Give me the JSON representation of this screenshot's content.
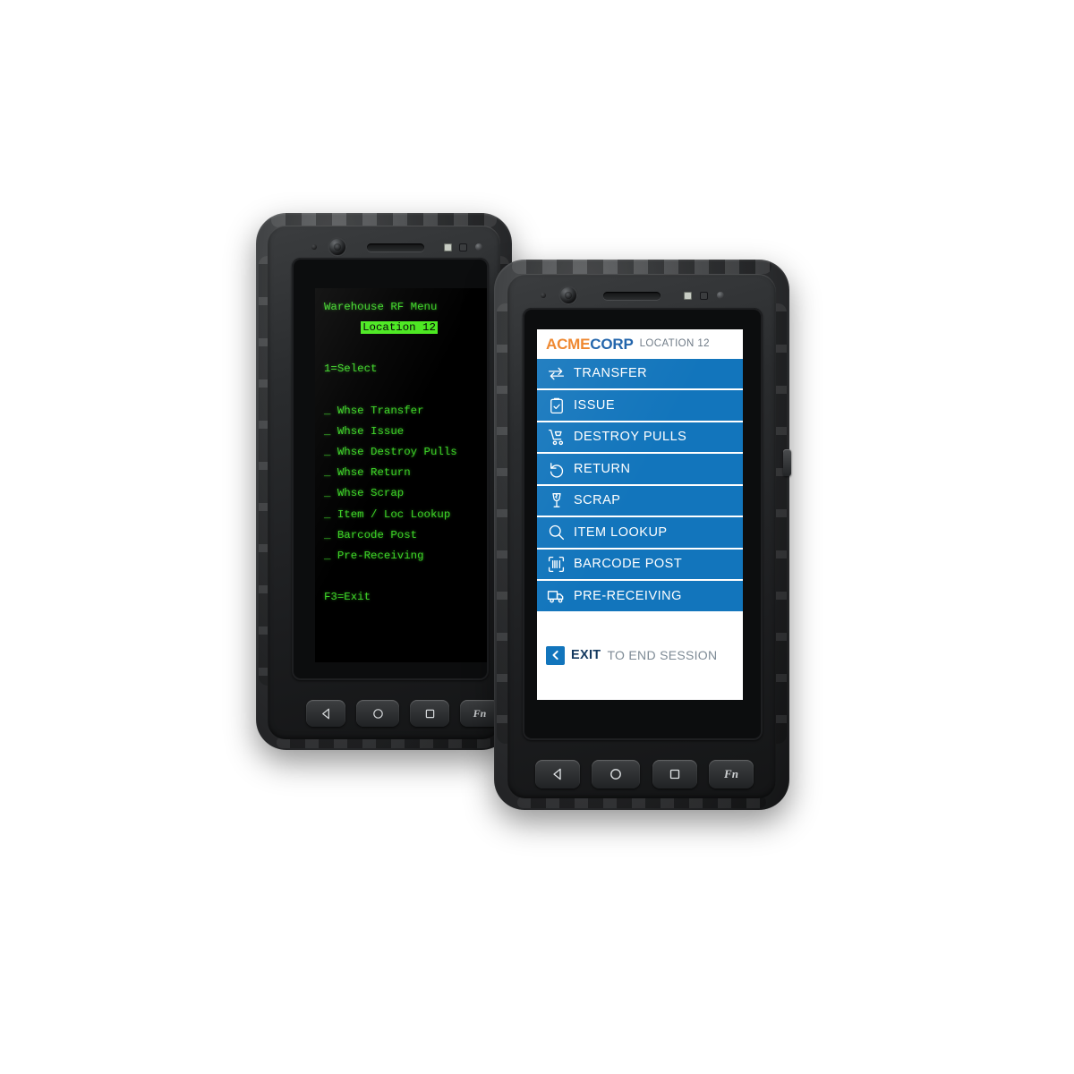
{
  "scene": {
    "background_color": "#ffffff",
    "device_count": 2
  },
  "legacy_device": {
    "name": "Rugged handheld terminal (legacy green-screen)",
    "hardware": {
      "camera_icon": "camera-lens-icon",
      "speaker_icon": "speaker-grille-icon",
      "nav_keys": [
        {
          "name": "back",
          "glyph": "back-triangle-icon",
          "label": ""
        },
        {
          "name": "home",
          "glyph": "home-circle-icon",
          "label": ""
        },
        {
          "name": "recents",
          "glyph": "recents-square-icon",
          "label": ""
        },
        {
          "name": "function",
          "glyph": "fn-key",
          "label": "Fn"
        }
      ]
    },
    "terminal": {
      "text_color": "#3ed428",
      "background_color": "#000000",
      "highlight_bg": "#4ae81f",
      "highlight_fg": "#000000",
      "title": "Warehouse RF Menu",
      "location": "Location 12",
      "prompt": "1=Select",
      "items": [
        "_ Whse Transfer",
        "_ Whse Issue",
        "_ Whse Destroy Pulls",
        "_ Whse Return",
        "_ Whse Scrap",
        "_ Item / Loc Lookup",
        "_ Barcode Post",
        "_ Pre-Receiving"
      ],
      "footer": "F3=Exit"
    }
  },
  "modern_device": {
    "name": "Rugged handheld terminal (modern touch UI)",
    "hardware": {
      "camera_icon": "camera-lens-icon",
      "speaker_icon": "speaker-grille-icon",
      "nav_keys": [
        {
          "name": "back",
          "glyph": "back-triangle-icon",
          "label": ""
        },
        {
          "name": "home",
          "glyph": "home-circle-icon",
          "label": ""
        },
        {
          "name": "recents",
          "glyph": "recents-square-icon",
          "label": ""
        },
        {
          "name": "function",
          "glyph": "fn-key",
          "label": "Fn"
        }
      ]
    },
    "app": {
      "colors": {
        "accent_blue": "#1275bc",
        "brand_orange": "#ee8022",
        "brand_navy": "#1a5fa8",
        "exit_navy": "#14395f",
        "muted_gray": "#7d8a95",
        "surface": "#ffffff"
      },
      "header": {
        "brand_first": "ACME",
        "brand_second": "CORP",
        "location": "LOCATION 12"
      },
      "menu_items": [
        {
          "label": "TRANSFER",
          "icon": "transfer-arrows-icon"
        },
        {
          "label": "ISSUE",
          "icon": "clipboard-check-icon"
        },
        {
          "label": "DESTROY PULLS",
          "icon": "hand-truck-icon"
        },
        {
          "label": "RETURN",
          "icon": "undo-arrow-icon"
        },
        {
          "label": "SCRAP",
          "icon": "broken-glass-icon"
        },
        {
          "label": "ITEM LOOKUP",
          "icon": "magnifier-icon"
        },
        {
          "label": "BARCODE POST",
          "icon": "barcode-scan-icon"
        },
        {
          "label": "PRE-RECEIVING",
          "icon": "delivery-truck-icon"
        }
      ],
      "exit": {
        "icon": "back-chevron-icon",
        "strong": "EXIT",
        "rest": "TO END SESSION"
      }
    }
  }
}
